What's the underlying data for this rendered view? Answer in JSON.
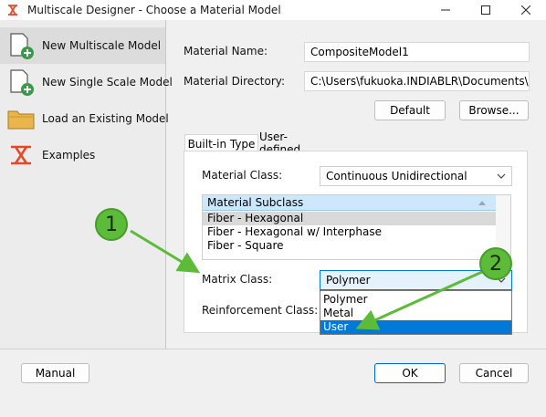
{
  "window": {
    "title": "Multiscale Designer - Choose a Material Model",
    "controls": [
      "minimize-icon",
      "maximize-icon",
      "close-icon"
    ]
  },
  "sidebar": {
    "items": [
      {
        "label": "New Multiscale Model",
        "icon": "new-document-icon",
        "selected": true
      },
      {
        "label": "New Single Scale Model",
        "icon": "new-document-icon",
        "selected": false
      },
      {
        "label": "Load an Existing Model",
        "icon": "folder-icon",
        "selected": false
      },
      {
        "label": "Examples",
        "icon": "app-logo-icon",
        "selected": false
      }
    ]
  },
  "form": {
    "material_name_label": "Material Name:",
    "material_name_value": "CompositeModel1",
    "material_dir_label": "Material Directory:",
    "material_dir_value": "C:\\Users\\fukuoka.INDIABLR\\Documents\\Mult",
    "default_button": "Default",
    "browse_button": "Browse..."
  },
  "tabs": [
    {
      "label": "Built-in Type",
      "active": true
    },
    {
      "label": "User-defined",
      "active": false
    }
  ],
  "builtin": {
    "material_class_label": "Material Class:",
    "material_class_value": "Continuous Unidirectional",
    "subclass_header": "Material Subclass",
    "subclass_items": [
      {
        "label": "Fiber - Hexagonal",
        "selected": true
      },
      {
        "label": "Fiber - Hexagonal w/ Interphase",
        "selected": false
      },
      {
        "label": "Fiber - Square",
        "selected": false
      }
    ],
    "matrix_class_label": "Matrix Class:",
    "matrix_class_value": "Polymer",
    "matrix_options": [
      {
        "label": "Polymer",
        "highlighted": false
      },
      {
        "label": "Metal",
        "highlighted": false
      },
      {
        "label": "User",
        "highlighted": true
      }
    ],
    "reinforcement_class_label": "Reinforcement Class:"
  },
  "footer": {
    "manual_button": "Manual",
    "ok_button": "OK",
    "cancel_button": "Cancel"
  },
  "callouts": [
    "1",
    "2"
  ],
  "colors": {
    "accent": "#0078d7",
    "callout_green": "#5dbb3a",
    "header_blue": "#cce8ff"
  }
}
